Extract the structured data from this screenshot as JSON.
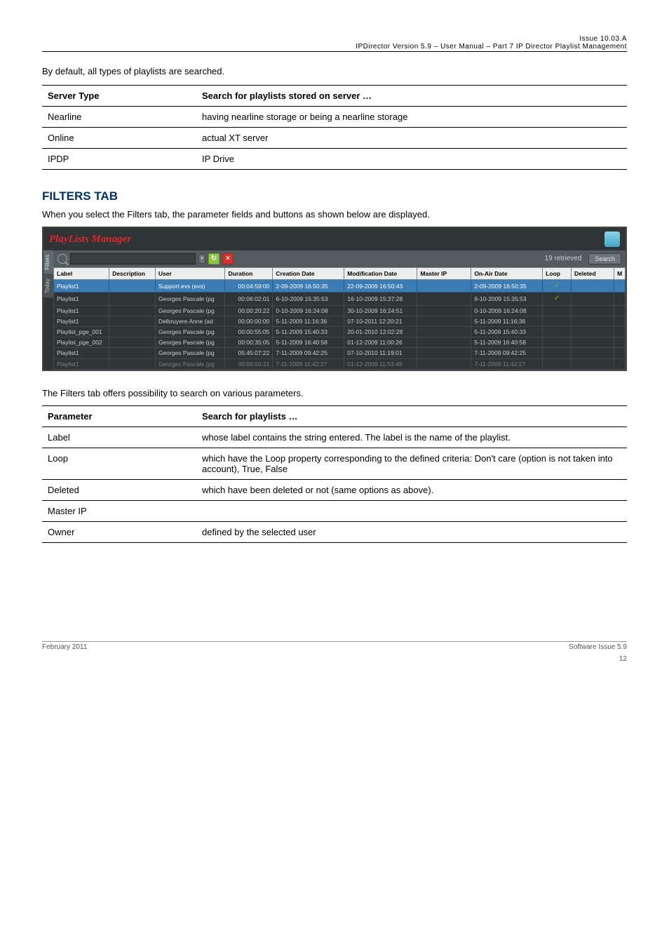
{
  "header": {
    "issue": "Issue 10.03.A",
    "product": "IPDirector Version 5.9 – User Manual – Part 7 IP Director Playlist Management"
  },
  "intro_line": "By default, all types of playlists are searched.",
  "types_table": {
    "head": [
      "Server Type",
      "Search for playlists stored on server …"
    ],
    "rows": [
      [
        "Nearline",
        "having nearline storage or being a nearline storage"
      ],
      [
        "Online",
        "actual XT server"
      ],
      [
        "IPDP",
        "IP Drive"
      ]
    ]
  },
  "filters_heading": "FILTERS TAB",
  "filters_body": "When you select the Filters tab, the parameter fields and buttons as shown below are displayed.",
  "filters_tagline": "The Filters tab offers possibility to search on various parameters.",
  "filters_table": {
    "head": [
      "Parameter",
      "Search for playlists …"
    ],
    "rows": [
      [
        "Label",
        "whose label contains the string entered. The label is the name of the playlist."
      ],
      [
        "Loop",
        "which have the Loop property corresponding to the defined criteria: Don't care (option is not taken into account), True, False"
      ],
      [
        "Deleted",
        "which have been deleted or not (same options as above)."
      ],
      [
        "Master IP",
        ""
      ],
      [
        "Owner",
        "defined by the selected user"
      ]
    ]
  },
  "app": {
    "title": "PlayLists Manager",
    "side_tabs": [
      "Filters",
      "Today"
    ],
    "search_placeholder": "",
    "retrieved": "19 retrieved",
    "search_btn": "Search",
    "columns": [
      "Label",
      "Description",
      "User",
      "Duration",
      "Creation Date",
      "Modification Date",
      "Master IP",
      "On-Air Date",
      "Loop",
      "Deleted",
      "M"
    ],
    "rows": [
      {
        "label": "Playlist1",
        "desc": "",
        "user": "Support evs (evs)",
        "dur": "00:04:59:00",
        "cdate": "2-09-2009 16:50:35",
        "mdate": "22-09-2009 16:50:43",
        "mip": "",
        "onair": "2-09-2009 16:50:35",
        "loop": "✓",
        "deleted": "",
        "m": "",
        "sel": true
      },
      {
        "label": "Playlist1",
        "desc": "",
        "user": "Georges Pascale (pg",
        "dur": "00:06:02:01",
        "cdate": "6-10-2009 15:35:53",
        "mdate": "16-10-2009 15:37:28",
        "mip": "",
        "onair": "6-10-2009 15:35:53",
        "loop": "✓",
        "deleted": "",
        "m": ""
      },
      {
        "label": "Playlist1",
        "desc": "",
        "user": "Georges Pascale (pg",
        "dur": "00:00:20:22",
        "cdate": "0-10-2009 16:24:08",
        "mdate": "30-10-2009 16:24:51",
        "mip": "",
        "onair": "0-10-2009 16:24:08",
        "loop": "",
        "deleted": "",
        "m": ""
      },
      {
        "label": "Playlist1",
        "desc": "",
        "user": "Delbruyere Anne (ad",
        "dur": "00:00:00:00",
        "cdate": "5-11-2009 11:16:36",
        "mdate": "07-10-2011 12:20:21",
        "mip": "",
        "onair": "5-11-2009 11:16:36",
        "loop": "",
        "deleted": "",
        "m": ""
      },
      {
        "label": "Playlist_pge_001",
        "desc": "",
        "user": "Georges Pascale (pg",
        "dur": "00:00:55:05",
        "cdate": "5-11-2009 15:40:33",
        "mdate": "20-01-2010 12:02:28",
        "mip": "",
        "onair": "5-11-2009 15:40:33",
        "loop": "",
        "deleted": "",
        "m": ""
      },
      {
        "label": "Playlist_pge_002",
        "desc": "",
        "user": "Georges Pascale (pg",
        "dur": "00:00:35:05",
        "cdate": "5-11-2009 16:40:58",
        "mdate": "01-12-2009 11:00:26",
        "mip": "",
        "onair": "5-11-2009 16:40:58",
        "loop": "",
        "deleted": "",
        "m": ""
      },
      {
        "label": "Playlist1",
        "desc": "",
        "user": "Georges Pascale (pg",
        "dur": "05:45:07:22",
        "cdate": "7-11-2009 09:42:25",
        "mdate": "07-10-2010 11:19:01",
        "mip": "",
        "onair": "7-11-2009 09:42:25",
        "loop": "",
        "deleted": "",
        "m": ""
      },
      {
        "label": "Playlist1",
        "desc": "",
        "user": "Georges Pascale (pg",
        "dur": "00:00:00:21",
        "cdate": "7-11-2009 11:42:27",
        "mdate": "01-12-2009 11:53:49",
        "mip": "",
        "onair": "7-11-2009 11:42:27",
        "loop": "",
        "deleted": "",
        "m": ""
      }
    ]
  },
  "footer": {
    "left": "February 2011",
    "right": "Software Issue 5.9",
    "page": "12"
  }
}
